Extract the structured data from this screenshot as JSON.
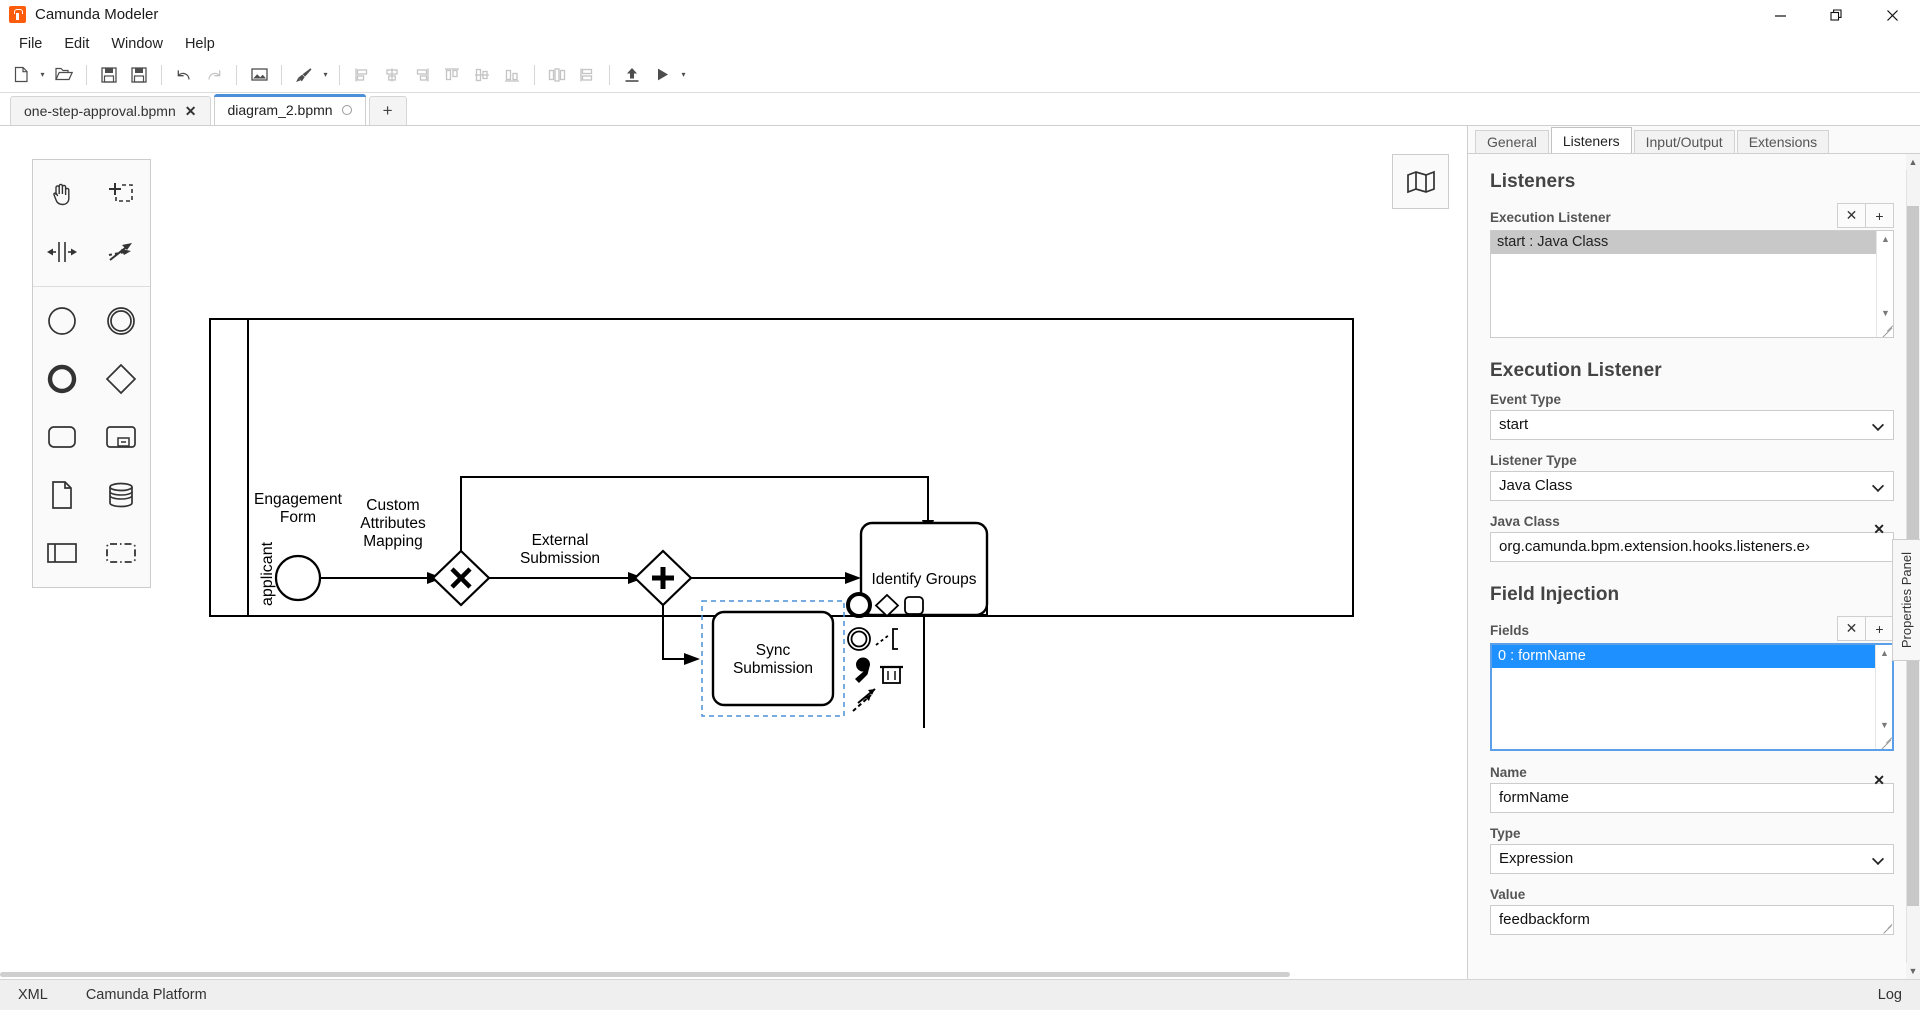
{
  "window": {
    "title": "Camunda Modeler",
    "app_icon": "camunda-logo-icon",
    "minimize": "—",
    "maximize": "❐",
    "close": "✕"
  },
  "menubar": {
    "items": [
      {
        "label": "File"
      },
      {
        "label": "Edit"
      },
      {
        "label": "Window"
      },
      {
        "label": "Help"
      }
    ]
  },
  "toolbar": {
    "buttons": [
      {
        "name": "new-diagram-icon",
        "dropdown": true,
        "disabled": false
      },
      {
        "name": "open-file-icon",
        "dropdown": false,
        "disabled": false
      },
      {
        "name": "save-icon",
        "dropdown": false,
        "disabled": false
      },
      {
        "name": "save-as-icon",
        "dropdown": false,
        "disabled": false
      },
      {
        "name": "undo-icon",
        "dropdown": false,
        "disabled": false
      },
      {
        "name": "redo-icon",
        "dropdown": false,
        "disabled": true
      },
      {
        "name": "export-image-icon",
        "dropdown": false,
        "disabled": false
      },
      {
        "name": "paintbrush-icon",
        "dropdown": true,
        "disabled": false
      },
      {
        "name": "align-left-icon",
        "dropdown": false,
        "disabled": true
      },
      {
        "name": "align-center-icon",
        "dropdown": false,
        "disabled": true
      },
      {
        "name": "align-right-icon",
        "dropdown": false,
        "disabled": true
      },
      {
        "name": "align-top-icon",
        "dropdown": false,
        "disabled": true
      },
      {
        "name": "align-middle-icon",
        "dropdown": false,
        "disabled": true
      },
      {
        "name": "align-bottom-icon",
        "dropdown": false,
        "disabled": true
      },
      {
        "name": "distribute-horizontal-icon",
        "dropdown": false,
        "disabled": true
      },
      {
        "name": "distribute-vertical-icon",
        "dropdown": false,
        "disabled": true
      },
      {
        "name": "deploy-icon",
        "dropdown": false,
        "disabled": false
      },
      {
        "name": "start-process-icon",
        "dropdown": true,
        "disabled": false
      }
    ],
    "caret": "▾"
  },
  "tabs": {
    "items": [
      {
        "label": "one-step-approval.bpmn",
        "active": false,
        "dirty": false,
        "close": "✕"
      },
      {
        "label": "diagram_2.bpmn",
        "active": true,
        "dirty": true,
        "close": ""
      }
    ],
    "add_label": "+"
  },
  "canvas": {
    "minimap_toggle_icon": "map-icon",
    "properties_panel_handle": "Properties Panel",
    "palette": {
      "groups": [
        [
          {
            "name": "hand-tool-icon"
          },
          {
            "name": "lasso-tool-icon"
          },
          {
            "name": "space-tool-icon"
          },
          {
            "name": "global-connect-tool-icon"
          }
        ],
        [
          {
            "name": "start-event-icon"
          },
          {
            "name": "intermediate-event-icon"
          },
          {
            "name": "end-event-icon"
          },
          {
            "name": "exclusive-gateway-icon"
          },
          {
            "name": "task-icon"
          },
          {
            "name": "subprocess-expanded-icon"
          },
          {
            "name": "data-object-icon"
          },
          {
            "name": "data-store-icon"
          },
          {
            "name": "participant-icon"
          },
          {
            "name": "group-icon"
          }
        ]
      ]
    },
    "diagram": {
      "pool_lane_label": "applicant",
      "elements": [
        {
          "name": "start-event",
          "type": "startEvent",
          "label": "Engagement Form"
        },
        {
          "name": "exclusive-gateway",
          "type": "exclusiveGateway",
          "label": "Custom Attributes Mapping"
        },
        {
          "name": "parallel-gateway",
          "type": "parallelGateway",
          "label": "External Submission"
        },
        {
          "name": "sync-submission-task",
          "type": "task",
          "label": "Sync Submission",
          "selected": true
        },
        {
          "name": "identify-groups-task",
          "type": "task",
          "label": "Identify Groups"
        }
      ],
      "context_pad": [
        {
          "name": "append-end-event-icon"
        },
        {
          "name": "append-gateway-icon"
        },
        {
          "name": "append-task-icon"
        },
        {
          "name": "append-intermediate-event-icon"
        },
        {
          "name": "append-text-annotation-icon"
        },
        {
          "name": "change-type-wrench-icon"
        },
        {
          "name": "delete-trash-icon"
        },
        {
          "name": "connect-icon"
        }
      ]
    }
  },
  "properties_panel": {
    "tabs": [
      {
        "label": "General",
        "active": false
      },
      {
        "label": "Listeners",
        "active": true
      },
      {
        "label": "Input/Output",
        "active": false
      },
      {
        "label": "Extensions",
        "active": false
      }
    ],
    "scroll_up_arrow": "▲",
    "scroll_down_arrow": "▼",
    "sections": {
      "listeners": {
        "title": "Listeners",
        "field_label": "Execution Listener",
        "remove_label": "✕",
        "add_label": "+",
        "options": [
          {
            "label": "start : Java Class",
            "selected": true
          }
        ]
      },
      "execution_listener": {
        "title": "Execution Listener",
        "event_type": {
          "label": "Event Type",
          "value": "start"
        },
        "listener_type": {
          "label": "Listener Type",
          "value": "Java Class"
        },
        "java_class": {
          "label": "Java Class",
          "value": "org.camunda.bpm.extension.hooks.listeners.e›",
          "clear": "✕"
        }
      },
      "field_injection": {
        "title": "Field Injection",
        "field_label": "Fields",
        "remove_label": "✕",
        "add_label": "+",
        "options": [
          {
            "label": "0 : formName",
            "selected": true
          }
        ],
        "name": {
          "label": "Name",
          "value": "formName",
          "clear": "✕"
        },
        "type": {
          "label": "Type",
          "value": "Expression"
        },
        "value": {
          "label": "Value",
          "value": "feedbackform"
        }
      }
    }
  },
  "statusbar": {
    "left": [
      {
        "label": "XML"
      },
      {
        "label": "Camunda Platform"
      }
    ],
    "right": {
      "label": "Log"
    }
  },
  "colors": {
    "accent_blue": "#4a90d9",
    "selection_blue": "#1e90ff",
    "brand_orange": "#fc5d0d",
    "panel_bg": "#fafafa",
    "status_bg": "#efefef"
  }
}
